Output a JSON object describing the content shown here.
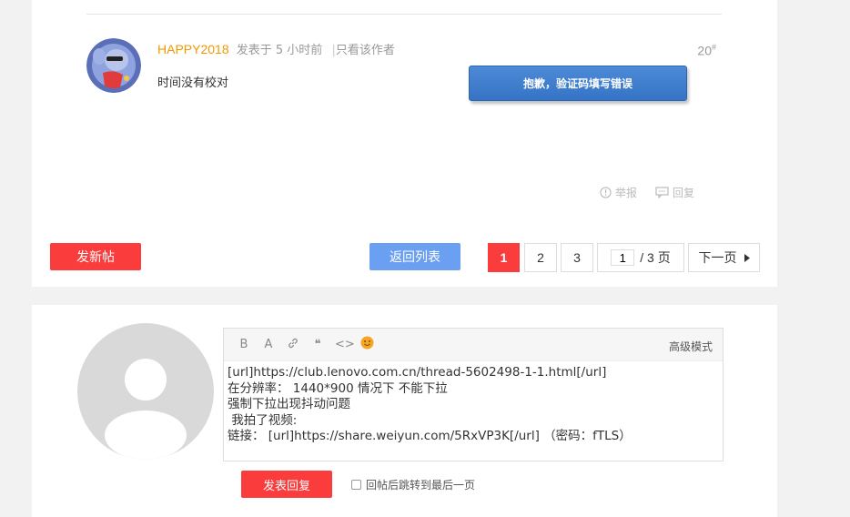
{
  "post": {
    "author": "HAPPY2018",
    "posted_time": "发表于 5 小时前",
    "separator": "|",
    "only_author": "只看该作者",
    "floor_number": "20",
    "floor_mark": "#",
    "content": "时间没有校对",
    "toast": "抱歉，验证码填写错误",
    "report_label": "举报",
    "reply_label": "回复"
  },
  "bar": {
    "new_post": "发新帖",
    "back_to_list": "返回列表",
    "pages": [
      "1",
      "2",
      "3"
    ],
    "current_page_input": "1",
    "total_pages": "/ 3 页",
    "next_page": "下一页"
  },
  "reply_form": {
    "toolbar": {
      "bold": "B",
      "font": "A",
      "quote": "❝",
      "code": "<>",
      "emoji": "😊",
      "advanced_mode": "高级模式"
    },
    "content": "[url]https://club.lenovo.com.cn/thread-5602498-1-1.html[/url]\n在分辨率： 1440*900 情况下 不能下拉\n强制下拉出现抖动问题\n 我拍了视频:\n链接： [url]https://share.weiyun.com/5RxVP3K[/url] （密码：fTLS）",
    "submit": "发表回复",
    "jump_checkbox_label": "回帖后跳转到最后一页"
  },
  "colors": {
    "accent_red": "#fb3c3c",
    "accent_blue": "#6a9ff2",
    "author_orange": "#f39800",
    "toast_blue": "#3a7bd0"
  },
  "icons": {
    "avatar_small": "cartoon-avatar",
    "report": "info-circle-icon",
    "reply": "comment-icon",
    "link": "link-icon",
    "next": "triangle-right-icon",
    "avatar_big": "default-user-avatar"
  }
}
